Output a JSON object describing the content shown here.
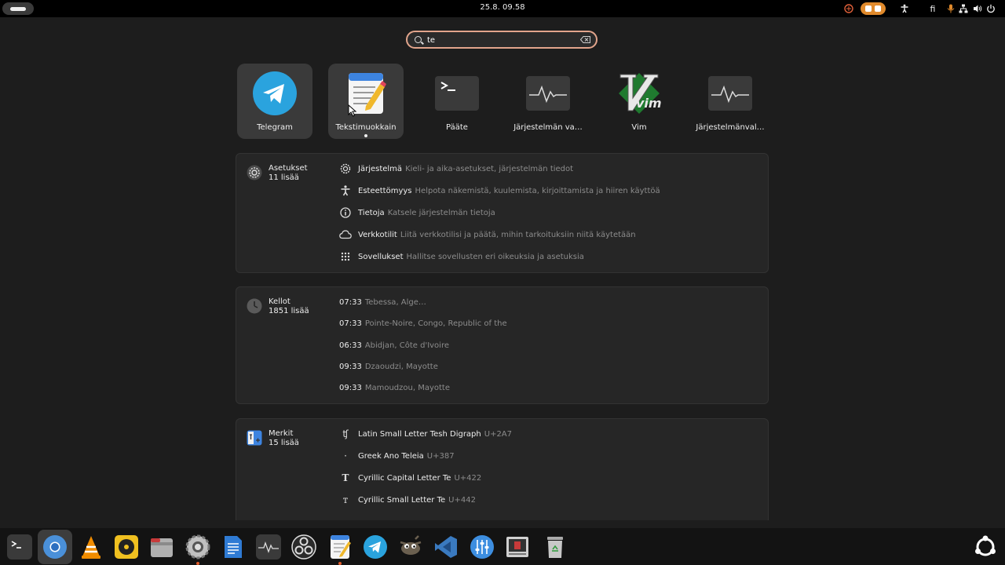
{
  "topbar": {
    "clock": "25.8.  09.58",
    "language": "fi",
    "icons": [
      "activities-indicator",
      "record-icon",
      "screencast-icon",
      "accessibility-icon",
      "language-indicator",
      "microphone-icon",
      "network-icon",
      "volume-icon",
      "power-icon"
    ]
  },
  "search": {
    "value": "te",
    "placeholder": ""
  },
  "apps": [
    {
      "label": "Telegram",
      "icon": "telegram-icon",
      "selected": true,
      "running": false
    },
    {
      "label": "Tekstimuokkain",
      "icon": "text-editor-icon",
      "selected": true,
      "running": true
    },
    {
      "label": "Pääte",
      "icon": "terminal-icon",
      "selected": false,
      "running": false
    },
    {
      "label": "Järjestelmän va…",
      "icon": "system-monitor-icon",
      "selected": false,
      "running": false
    },
    {
      "label": "Vim",
      "icon": "vim-icon",
      "selected": false,
      "running": false
    },
    {
      "label": "Järjestelmänval…",
      "icon": "system-monitor-icon",
      "selected": false,
      "running": false
    }
  ],
  "settings": {
    "name": "Asetukset",
    "more": "11 lisää",
    "icon": "settings-gear-icon",
    "rows": [
      {
        "title": "Järjestelmä",
        "desc": "Kieli- ja aika-asetukset, järjestelmän tiedot",
        "icon": "gear-icon"
      },
      {
        "title": "Esteettömyys",
        "desc": "Helpota näkemistä, kuulemista, kirjoittamista ja hiiren käyttöä",
        "icon": "accessibility-icon"
      },
      {
        "title": "Tietoja",
        "desc": "Katsele järjestelmän tietoja",
        "icon": "info-icon"
      },
      {
        "title": "Verkkotilit",
        "desc": "Liitä verkkotilisi ja päätä, mihin tarkoituksiin niitä käytetään",
        "icon": "cloud-icon"
      },
      {
        "title": "Sovellukset",
        "desc": "Hallitse sovellusten eri oikeuksia ja asetuksia",
        "icon": "apps-grid-icon"
      }
    ]
  },
  "clocks": {
    "name": "Kellot",
    "more": "1851 lisää",
    "icon": "clock-icon",
    "rows": [
      {
        "title": "07:33",
        "desc": "Tebessa, Alge…"
      },
      {
        "title": "07:33",
        "desc": "Pointe-Noire, Congo, Republic of the"
      },
      {
        "title": "06:33",
        "desc": "Abidjan, Côte d'Ivoire"
      },
      {
        "title": "09:33",
        "desc": "Dzaoudzi, Mayotte"
      },
      {
        "title": "09:33",
        "desc": "Mamoudzou, Mayotte"
      }
    ]
  },
  "chars": {
    "name": "Merkit",
    "more": "15 lisää",
    "icon": "characters-icon",
    "rows": [
      {
        "glyph": "ʧ",
        "title": "Latin Small Letter Tesh Digraph",
        "desc": "U+2A7"
      },
      {
        "glyph": "·",
        "title": "Greek Ano Teleia",
        "desc": "U+387"
      },
      {
        "glyph": "Т",
        "title": "Cyrillic Capital Letter Te",
        "desc": "U+422"
      },
      {
        "glyph": "т",
        "title": "Cyrillic Small Letter Te",
        "desc": "U+442"
      }
    ]
  },
  "dock": [
    {
      "name": "terminal-icon",
      "color": "#3a3a3a",
      "running": false
    },
    {
      "name": "chromium-icon",
      "color": "#4a90d9",
      "running": false,
      "selected": true
    },
    {
      "name": "vlc-icon",
      "color": "#f08c00",
      "running": false
    },
    {
      "name": "rhythmbox-icon",
      "color": "#f0c020",
      "running": false
    },
    {
      "name": "files-icon",
      "color": "#b0b0b0",
      "running": false
    },
    {
      "name": "settings-icon",
      "color": "#c0c0c0",
      "running": true
    },
    {
      "name": "libreoffice-writer-icon",
      "color": "#2f7bd4",
      "running": false
    },
    {
      "name": "system-monitor-icon",
      "color": "#3a3a3a",
      "running": false
    },
    {
      "name": "obs-icon",
      "color": "#2b2b2b",
      "running": false
    },
    {
      "name": "text-editor-icon",
      "color": "#4a8ae0",
      "running": true
    },
    {
      "name": "telegram-icon",
      "color": "#2aa3de",
      "running": false
    },
    {
      "name": "gimp-icon",
      "color": "#6b6050",
      "running": false
    },
    {
      "name": "vscode-icon",
      "color": "#3a7ac0",
      "running": false
    },
    {
      "name": "equalizer-icon",
      "color": "#3d8ee0",
      "running": false
    },
    {
      "name": "app-icon",
      "color": "#d0d0d0",
      "running": false
    },
    {
      "name": "trash-icon",
      "color": "#c8c8c8",
      "running": false
    },
    {
      "name": "show-apps-icon",
      "color": "#ffffff",
      "running": false
    }
  ]
}
